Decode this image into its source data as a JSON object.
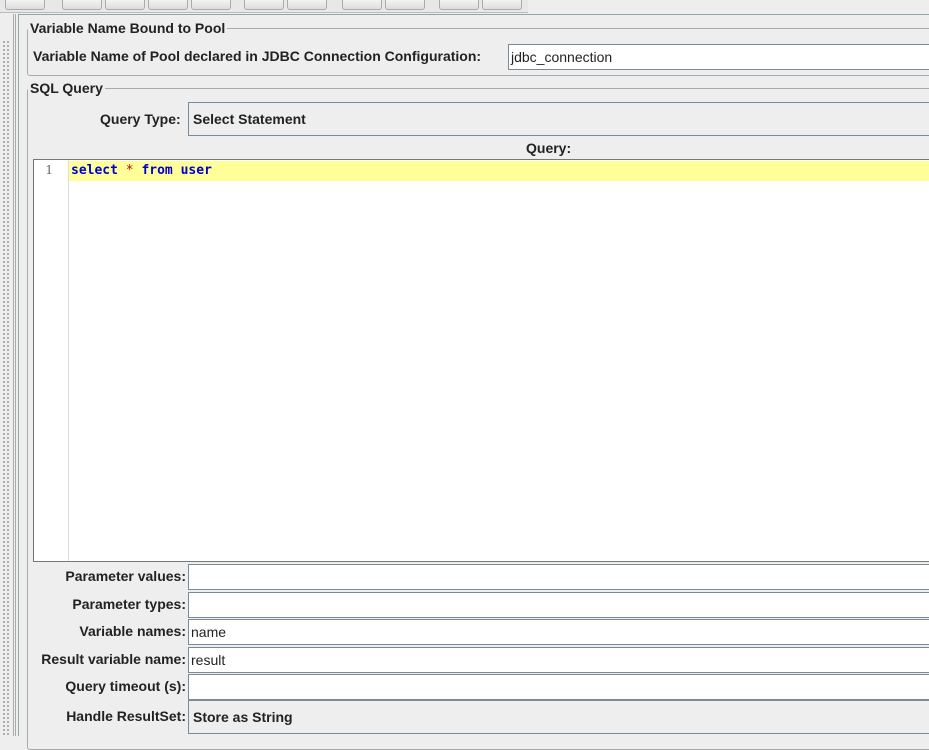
{
  "pool_section": {
    "legend": "Variable Name Bound to Pool",
    "pool_label": "Variable Name of Pool declared in JDBC Connection Configuration:",
    "pool_value": "jdbc_connection"
  },
  "sql_section": {
    "legend": "SQL Query",
    "query_type_label": "Query Type:",
    "query_type_value": "Select Statement",
    "query_label": "Query:",
    "editor": {
      "line_number": "1",
      "tokens": {
        "k1": "select",
        "op": "*",
        "k2": "from",
        "k3": "user"
      }
    }
  },
  "params": {
    "parameter_values_label": "Parameter values:",
    "parameter_values": "",
    "parameter_types_label": "Parameter types:",
    "parameter_types": "",
    "variable_names_label": "Variable names:",
    "variable_names": "name",
    "result_variable_label": "Result variable name:",
    "result_variable": "result",
    "query_timeout_label": "Query timeout (s):",
    "query_timeout": "",
    "handle_resultset_label": "Handle ResultSet:",
    "handle_resultset": "Store as String"
  },
  "colors": {
    "current_line": "#ffff99",
    "keyword": "#0000cc",
    "operator": "#cc0000"
  }
}
